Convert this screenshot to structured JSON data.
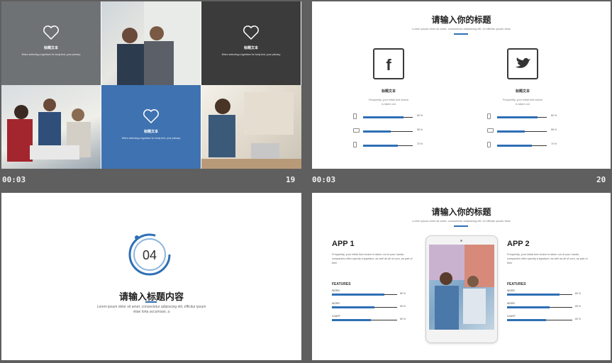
{
  "slide1": {
    "tiles": [
      {
        "title": "标题文本",
        "desc": "When selecting a typeface for body text, your primary"
      },
      {
        "title": "标题文本",
        "desc": "When selecting a typeface for body text, your primary"
      },
      {
        "title": "标题文本",
        "desc": "When selecting a typeface for body text, your primary"
      }
    ],
    "time": "00:03",
    "number": "19"
  },
  "slide2": {
    "title": "请输入你的标题",
    "subtitle": "Lorem ipsum dolor sit amet, consectetur adipisicing elit. Ut efficitur ipsum vitae",
    "columns": [
      {
        "icon": "facebook-icon",
        "title": "标题文本",
        "desc": "Frequently, your initial font choice is taken out",
        "bars": [
          {
            "device": "phone",
            "value": 0.82,
            "label": "82 %"
          },
          {
            "device": "laptop",
            "value": 0.55,
            "label": "55 %"
          },
          {
            "device": "tablet",
            "value": 0.7,
            "label": "70 %"
          }
        ]
      },
      {
        "icon": "twitter-icon",
        "title": "标题文本",
        "desc": "Frequently, your initial font choice is taken out",
        "bars": [
          {
            "device": "phone",
            "value": 0.82,
            "label": "82 %"
          },
          {
            "device": "laptop",
            "value": 0.55,
            "label": "55 %"
          },
          {
            "device": "tablet",
            "value": 0.7,
            "label": "70 %"
          }
        ]
      }
    ],
    "time": "00:03",
    "number": "20"
  },
  "slide3": {
    "number": "04",
    "title": "请输入标题内容",
    "desc": "Lorem ipsum dolor sit amet, consectetur adipiscing elit, efficitur ipsum vitae lorta accumsan, a"
  },
  "slide4": {
    "title": "请输入你的标题",
    "subtitle": "Lorem ipsum dolor sit amet, consectetur adipisicing elit. Ut efficitur ipsum vitae",
    "apps": [
      {
        "name": "APP 1",
        "desc": "Frequently, your initial font choice is taken out of your hands; companies often specify a typeface, as well as all of ours, as part of their",
        "features_title": "FEATURES",
        "features": [
          {
            "label": "WORD",
            "value": 0.8,
            "text": "80 %"
          },
          {
            "label": "WORD",
            "value": 0.65,
            "text": "65 %"
          },
          {
            "label": "CHART",
            "value": 0.6,
            "text": "60 %"
          }
        ]
      },
      {
        "name": "APP 2",
        "desc": "Frequently, your initial font choice is taken out of your hands; companies often specify a typeface, as well as all of ours, as part of their",
        "features_title": "FEATURES",
        "features": [
          {
            "label": "WORD",
            "value": 0.8,
            "text": "80 %"
          },
          {
            "label": "WORD",
            "value": 0.65,
            "text": "65 %"
          },
          {
            "label": "CHART",
            "value": 0.6,
            "text": "60 %"
          }
        ]
      }
    ]
  },
  "colors": {
    "accent": "#2e6fb5",
    "tile_gray": "#6f7275",
    "tile_dark": "#3b3b3b",
    "tile_blue": "#3f72b0"
  }
}
